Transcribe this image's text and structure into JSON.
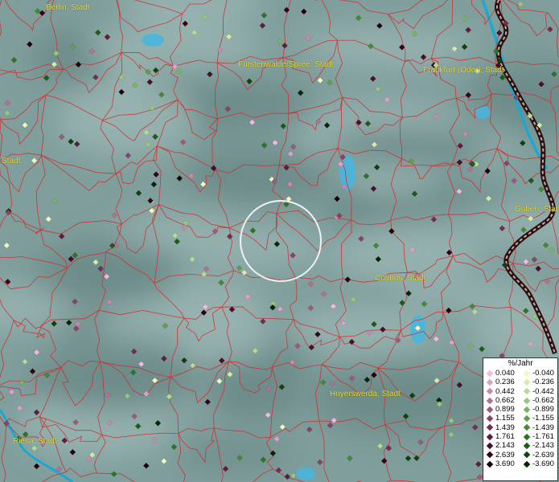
{
  "map": {
    "background_color": "#7f9e9c",
    "boundary_color": "#d42a2a",
    "river_color": "#1aa8d0",
    "lake_color": "#45b6e0",
    "border_line_color": "#2a1010",
    "cities": [
      {
        "name": "Berlin, Stadt"
      },
      {
        "name": "Fürstenwalde/Spree, Stadt"
      },
      {
        "name": "Frankfurt (Oder), Stadt"
      },
      {
        "name": "Stadt"
      },
      {
        "name": "Guben, Stadt"
      },
      {
        "name": "Cottbus, Stadt"
      },
      {
        "name": "Hoyerswerda, Stadt"
      },
      {
        "name": "Riesa, Stadt"
      }
    ]
  },
  "legend": {
    "title": "%/Jahr",
    "positive": [
      {
        "value": "0.040",
        "color": "#f2b8e0"
      },
      {
        "value": "0.236",
        "color": "#e0a0c8"
      },
      {
        "value": "0.442",
        "color": "#c88aac"
      },
      {
        "value": "0.662",
        "color": "#b47094"
      },
      {
        "value": "0.899",
        "color": "#9c5a7c"
      },
      {
        "value": "1.155",
        "color": "#884466"
      },
      {
        "value": "1.439",
        "color": "#742e50"
      },
      {
        "value": "1.761",
        "color": "#601c3c"
      },
      {
        "value": "2.143",
        "color": "#4c0c2a"
      },
      {
        "value": "2.639",
        "color": "#380018"
      },
      {
        "value": "3.690",
        "color": "#200008"
      }
    ],
    "negative": [
      {
        "value": "-0.040",
        "color": "#f0f8c0"
      },
      {
        "value": "-0.236",
        "color": "#d4ecaa"
      },
      {
        "value": "-0.442",
        "color": "#b4dc94"
      },
      {
        "value": "-0.662",
        "color": "#94c87c"
      },
      {
        "value": "-0.899",
        "color": "#78b464"
      },
      {
        "value": "-1.155",
        "color": "#5ea04c"
      },
      {
        "value": "-1.439",
        "color": "#448a36"
      },
      {
        "value": "-1.761",
        "color": "#2e7426"
      },
      {
        "value": "-2.143",
        "color": "#1c5c18"
      },
      {
        "value": "-2.639",
        "color": "#0e420c"
      },
      {
        "value": "-3.690",
        "color": "#042404"
      }
    ]
  }
}
